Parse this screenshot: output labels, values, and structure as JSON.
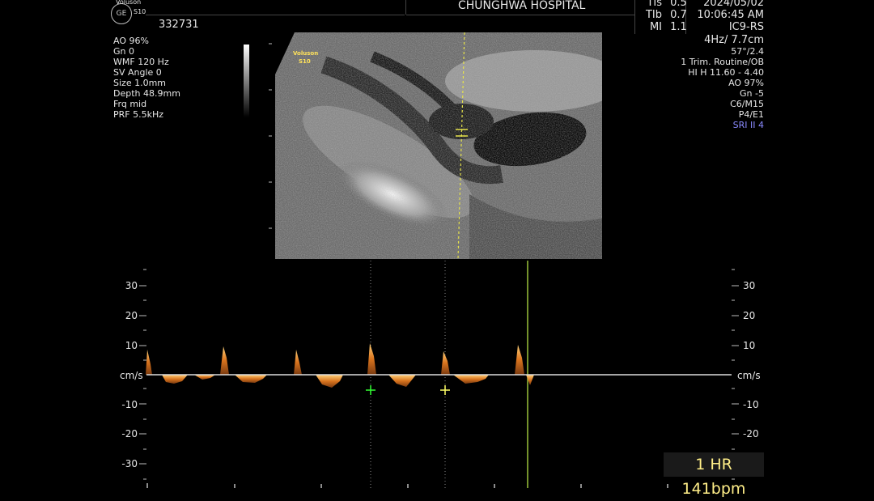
{
  "header": {
    "hospital": "CHUNGHWA HOSPITAL",
    "patient_id": "332731",
    "date": "2024/05/02",
    "time": "10:06:45 AM",
    "brand_top": "Voluson",
    "model_top": "S10",
    "logo_text": "GE"
  },
  "safety": [
    {
      "label": "TIs",
      "value": "0.5"
    },
    {
      "label": "TIb",
      "value": "0.7"
    },
    {
      "label": "MI",
      "value": "1.1"
    }
  ],
  "left_params": [
    "AO 96%",
    "Gn  0",
    "WMF 120 Hz",
    "SV Angle  0",
    "Size  1.0mm",
    "Depth 48.9mm",
    "Frq mid",
    "PRF  5.5kHz"
  ],
  "right_params": {
    "probe": "IC9-RS",
    "frame": "4Hz/ 7.7cm",
    "lines": [
      "57°/2.4",
      "1 Trim. Routine/OB",
      "HI H  11.60 - 4.40",
      "AO 97%",
      "Gn  -5",
      "C6/M15",
      "P4/E1"
    ],
    "sri": "SRI II 4"
  },
  "image_overlay": {
    "brand": "Voluson",
    "model": "S10"
  },
  "spectrum": {
    "unit": "cm/s",
    "scale_labels": [
      "30",
      "20",
      "10",
      "-10",
      "-20",
      "-30"
    ]
  },
  "heart_rate": "1 HR 141bpm",
  "colors": {
    "background": "#000000",
    "doppler_orange": "#d9741e",
    "hr_text": "#ffee88",
    "sri_blue": "#8a8aff",
    "caliper_green": "#33ff33",
    "caliper_yellow": "#ffff66"
  }
}
